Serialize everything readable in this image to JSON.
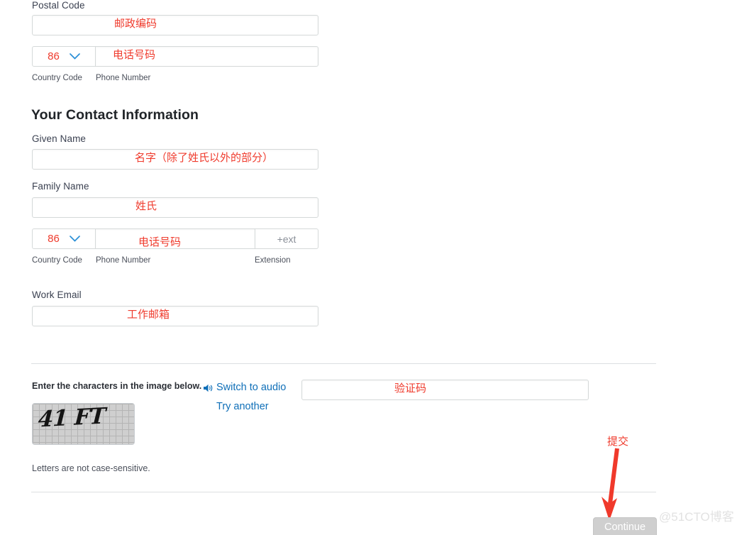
{
  "form": {
    "postal": {
      "label": "Postal Code",
      "annotation": "邮政编码",
      "value": ""
    },
    "phone_top": {
      "country_code": "86",
      "country_code_sublabel": "Country Code",
      "phone_sublabel": "Phone Number",
      "phone_annotation": "电话号码",
      "phone_value": ""
    },
    "section_heading": "Your Contact Information",
    "given_name": {
      "label": "Given Name",
      "annotation": "名字（除了姓氏以外的部分）",
      "value": ""
    },
    "family_name": {
      "label": "Family Name",
      "annotation": "姓氏",
      "value": ""
    },
    "phone_contact": {
      "country_code": "86",
      "country_code_sublabel": "Country Code",
      "phone_sublabel": "Phone Number",
      "phone_annotation": "电话号码",
      "phone_value": "",
      "extension_placeholder": "+ext",
      "extension_sublabel": "Extension",
      "extension_value": ""
    },
    "work_email": {
      "label": "Work Email",
      "annotation": "工作邮箱",
      "value": ""
    }
  },
  "captcha": {
    "instruction": "Enter the characters in the image below.",
    "switch_to_audio_link": "Switch to audio",
    "try_another_link": "Try another",
    "image_text": "41 FT",
    "note": "Letters are not case-sensitive.",
    "input_value": "",
    "input_annotation": "验证码"
  },
  "footer": {
    "continue_label": "Continue",
    "submit_annotation": "提交",
    "watermark": "@51CTO博客"
  },
  "colors": {
    "annotation_red": "#ef3b2d",
    "link_blue": "#0f6fb8",
    "label_dark": "#3b4151",
    "button_gray": "#cfcfcf",
    "border_gray": "#d5d9d9"
  }
}
